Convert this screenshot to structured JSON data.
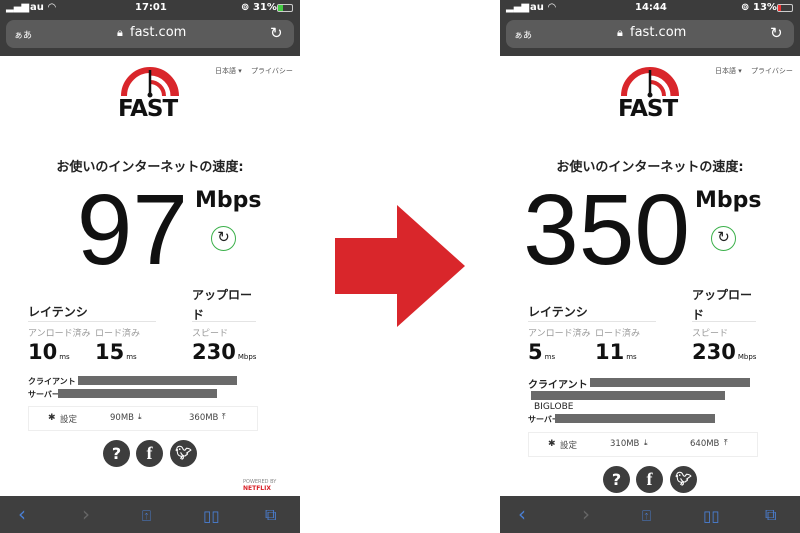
{
  "phones": [
    {
      "time": "17:01",
      "carrier": "au",
      "battery": "31%",
      "kana": "ぁあ",
      "url": "fast.com",
      "lang": "日本語 ▾",
      "privacy": "プライバシー",
      "logo": "FAST",
      "heading": "お使いのインターネットの速度:",
      "speed": "97",
      "unit": "Mbps",
      "latency": "レイテンシ",
      "upload1": "アップロー",
      "upload2": "ド",
      "unloaded": "アンロード済み",
      "loaded": "ロード済み",
      "upspeed": "スピード",
      "unloaded_val": "10",
      "loaded_val": "15",
      "ms": "ms",
      "up_val": "230",
      "up_unit": "Mbps",
      "client": "クライアント",
      "isp": "",
      "server": "サーバー",
      "settings": "設定",
      "dl_size": "90MB",
      "ul_size": "360MB",
      "powered": "POWERED BY",
      "netflix": "NETFLIX"
    },
    {
      "time": "14:44",
      "carrier": "au",
      "battery": "13%",
      "kana": "ぁあ",
      "url": "fast.com",
      "lang": "日本語 ▾",
      "privacy": "プライバシー",
      "logo": "FAST",
      "heading": "お使いのインターネットの速度:",
      "speed": "350",
      "unit": "Mbps",
      "latency": "レイテンシ",
      "upload1": "アップロー",
      "upload2": "ド",
      "unloaded": "アンロード済み",
      "loaded": "ロード済み",
      "upspeed": "スピード",
      "unloaded_val": "5",
      "loaded_val": "11",
      "ms": "ms",
      "up_val": "230",
      "up_unit": "Mbps",
      "client": "クライアント",
      "isp": "BIGLOBE",
      "server": "サーバー",
      "settings": "設定",
      "dl_size": "310MB",
      "ul_size": "640MB",
      "powered": "",
      "netflix": ""
    }
  ],
  "arrow_color": "#d9262b",
  "accent_green": "#3bb04a"
}
